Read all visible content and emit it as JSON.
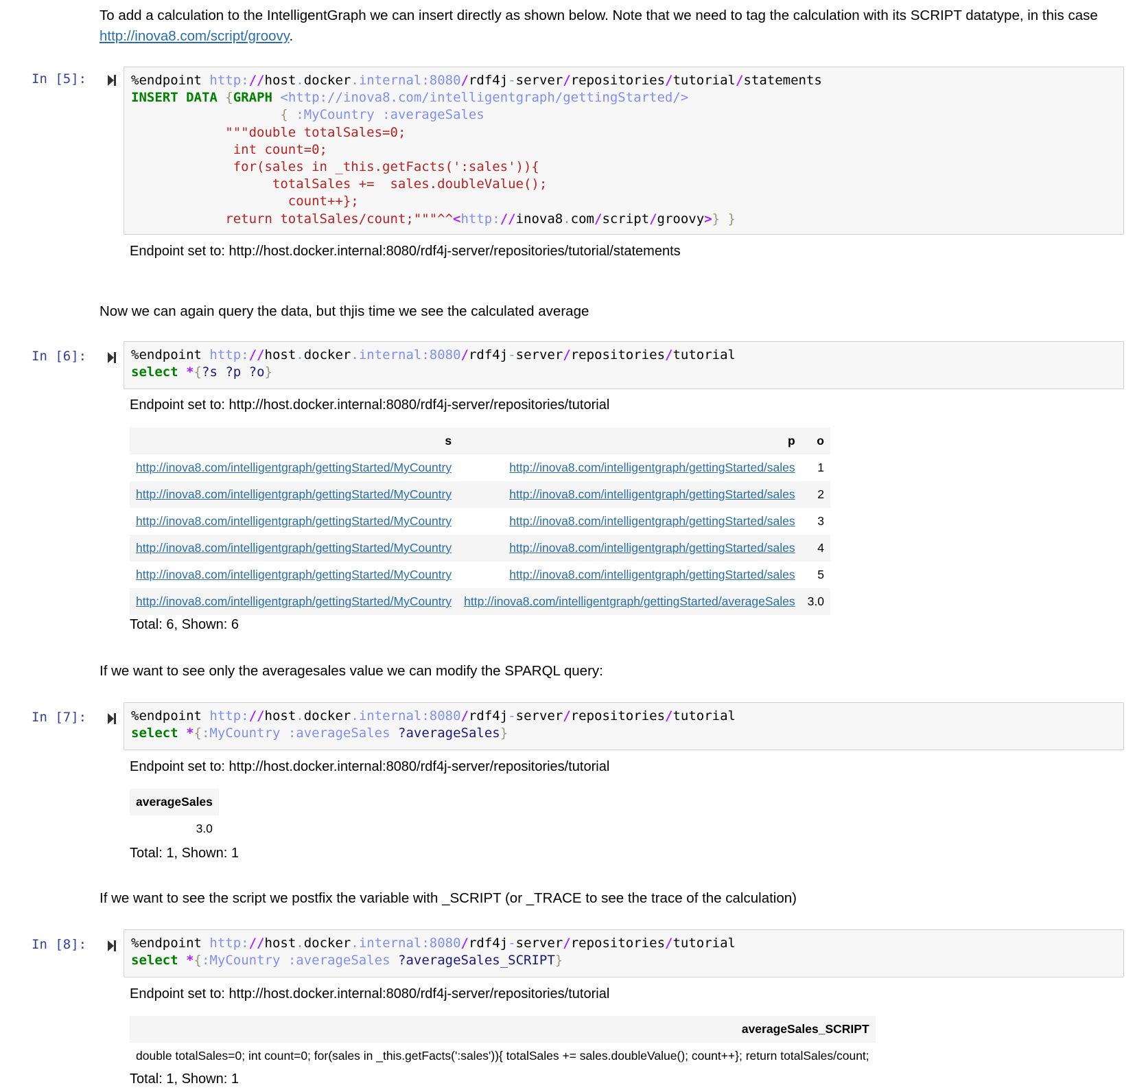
{
  "intro": {
    "text": "To add a calculation to the IntelligentGraph we can insert directly as shown below. Note that we need to tag the calculation with its SCRIPT datatype, in this case ",
    "link": "http://inova8.com/script/groovy",
    "after": "."
  },
  "cells": [
    {
      "prompt": "In [5]:",
      "output": "Endpoint set to: http://host.docker.internal:8080/rdf4j-server/repositories/tutorial/statements"
    },
    {
      "prompt": "In [6]:",
      "output": "Endpoint set to: http://host.docker.internal:8080/rdf4j-server/repositories/tutorial",
      "table": {
        "headers": [
          "s",
          "p",
          "o"
        ],
        "rows": [
          [
            "http://inova8.com/intelligentgraph/gettingStarted/MyCountry",
            "http://inova8.com/intelligentgraph/gettingStarted/sales",
            "1"
          ],
          [
            "http://inova8.com/intelligentgraph/gettingStarted/MyCountry",
            "http://inova8.com/intelligentgraph/gettingStarted/sales",
            "2"
          ],
          [
            "http://inova8.com/intelligentgraph/gettingStarted/MyCountry",
            "http://inova8.com/intelligentgraph/gettingStarted/sales",
            "3"
          ],
          [
            "http://inova8.com/intelligentgraph/gettingStarted/MyCountry",
            "http://inova8.com/intelligentgraph/gettingStarted/sales",
            "4"
          ],
          [
            "http://inova8.com/intelligentgraph/gettingStarted/MyCountry",
            "http://inova8.com/intelligentgraph/gettingStarted/sales",
            "5"
          ],
          [
            "http://inova8.com/intelligentgraph/gettingStarted/MyCountry",
            "http://inova8.com/intelligentgraph/gettingStarted/averageSales",
            "3.0"
          ]
        ],
        "total": "Total: 6, Shown: 6"
      }
    },
    {
      "prompt": "In [7]:",
      "output": "Endpoint set to: http://host.docker.internal:8080/rdf4j-server/repositories/tutorial",
      "table": {
        "headers": [
          "averageSales"
        ],
        "rows": [
          [
            "3.0"
          ]
        ],
        "total": "Total: 1, Shown: 1"
      }
    },
    {
      "prompt": "In [8]:",
      "output": "Endpoint set to: http://host.docker.internal:8080/rdf4j-server/repositories/tutorial",
      "table": {
        "headers": [
          "averageSales_SCRIPT"
        ],
        "rows": [
          [
            "double totalSales=0; int count=0; for(sales in _this.getFacts(':sales')){ totalSales += sales.doubleValue(); count++}; return totalSales/count;"
          ]
        ],
        "total": "Total: 1, Shown: 1"
      }
    }
  ],
  "md2": "Now we can again query the data, but thjis time we see the calculated average",
  "md3": "If we want to see only the averagesales value we can modify the SPARQL query:",
  "md4": "If we want to see the script we postfix the variable with _SCRIPT (or _TRACE to see the trace of the calculation)",
  "code": {
    "endpoint_cmd": "%endpoint",
    "url_scheme": "http:",
    "url_slashes": "//",
    "url_host1": "host",
    "url_dot": ".",
    "url_host2": "docker",
    "url_host3": "internal:8080",
    "url_slash": "/",
    "url_rdf4j": "rdf4j",
    "url_dash": "-",
    "url_server": "server",
    "url_repos": "repositories",
    "url_tutorial": "tutorial",
    "url_statements": "statements",
    "c5_insert": "INSERT DATA",
    "c5_graph": "GRAPH",
    "c5_graph_iri": "<http://inova8.com/intelligentgraph/gettingStarted/>",
    "c5_subj_pred": ":MyCountry :averageSales",
    "c5_s1": "\"\"\"double totalSales=0;",
    "c5_s2": "int count=0;",
    "c5_s3": "for(sales in _this.getFacts(':sales')){",
    "c5_s4": "totalSales +=  sales.doubleValue();",
    "c5_s5": "count++};",
    "c5_s6": "return totalSales/count;\"\"\"",
    "c5_caret": "^^",
    "c5_lt": "<",
    "c5_inova": "inova8",
    "c5_com": "com",
    "c5_script": "script",
    "c5_groovy": "groovy",
    "c5_gt": ">",
    "select": "select",
    "star": "*",
    "c6_vars": "?s ?p ?o",
    "c7_sp": ":MyCountry :averageSales",
    "c7_var": "?averageSales",
    "c8_var": "?averageSales_SCRIPT"
  }
}
